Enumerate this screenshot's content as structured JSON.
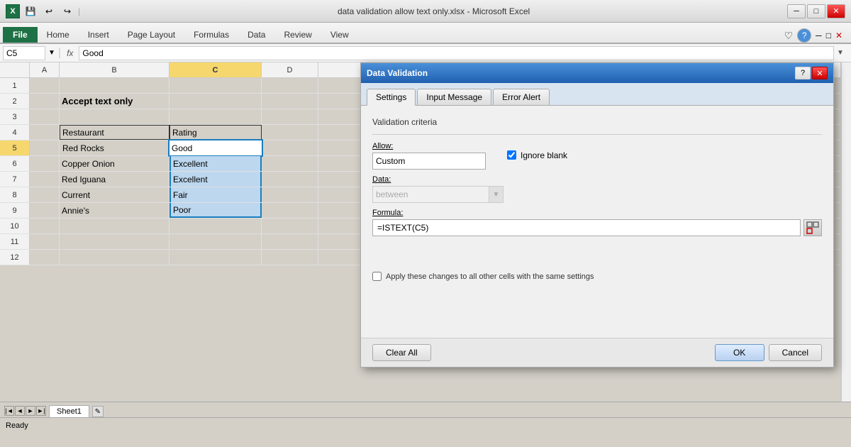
{
  "titlebar": {
    "title": "data validation allow text only.xlsx - Microsoft Excel",
    "min_label": "─",
    "max_label": "□",
    "close_label": "✕"
  },
  "ribbon": {
    "tabs": [
      "File",
      "Home",
      "Insert",
      "Page Layout",
      "Formulas",
      "Data",
      "Review",
      "View"
    ]
  },
  "formula_bar": {
    "cell_ref": "C5",
    "fx": "fx",
    "value": "Good"
  },
  "spreadsheet": {
    "col_headers": [
      "A",
      "B",
      "C",
      "D"
    ],
    "rows": [
      {
        "row_num": 1,
        "a": "",
        "b": "",
        "c": "",
        "d": ""
      },
      {
        "row_num": 2,
        "a": "",
        "b": "Accept text only",
        "c": "",
        "d": ""
      },
      {
        "row_num": 3,
        "a": "",
        "b": "",
        "c": "",
        "d": ""
      },
      {
        "row_num": 4,
        "a": "",
        "b": "Restaurant",
        "c": "Rating",
        "d": ""
      },
      {
        "row_num": 5,
        "a": "",
        "b": "Red Rocks",
        "c": "Good",
        "d": ""
      },
      {
        "row_num": 6,
        "a": "",
        "b": "Copper Onion",
        "c": "Excellent",
        "d": ""
      },
      {
        "row_num": 7,
        "a": "",
        "b": "Red Iguana",
        "c": "Excellent",
        "d": ""
      },
      {
        "row_num": 8,
        "a": "",
        "b": "Current",
        "c": "Fair",
        "d": ""
      },
      {
        "row_num": 9,
        "a": "",
        "b": "Annie's",
        "c": "Poor",
        "d": ""
      },
      {
        "row_num": 10,
        "a": "",
        "b": "",
        "c": "",
        "d": ""
      },
      {
        "row_num": 11,
        "a": "",
        "b": "",
        "c": "",
        "d": ""
      },
      {
        "row_num": 12,
        "a": "",
        "b": "",
        "c": "",
        "d": ""
      }
    ]
  },
  "sheet_tabs": [
    "Sheet1"
  ],
  "dialog": {
    "title": "Data Validation",
    "tabs": [
      "Settings",
      "Input Message",
      "Error Alert"
    ],
    "active_tab": "Settings",
    "section_title": "Validation criteria",
    "allow_label": "Allow:",
    "allow_value": "Custom",
    "ignore_blank_label": "Ignore blank",
    "data_label": "Data:",
    "data_value": "between",
    "formula_label": "Formula:",
    "formula_value": "=ISTEXT(C5)",
    "apply_label": "Apply these changes to all other cells with the same settings",
    "buttons": {
      "clear_all": "Clear All",
      "ok": "OK",
      "cancel": "Cancel"
    }
  },
  "status_bar": {
    "ready": "Ready"
  }
}
